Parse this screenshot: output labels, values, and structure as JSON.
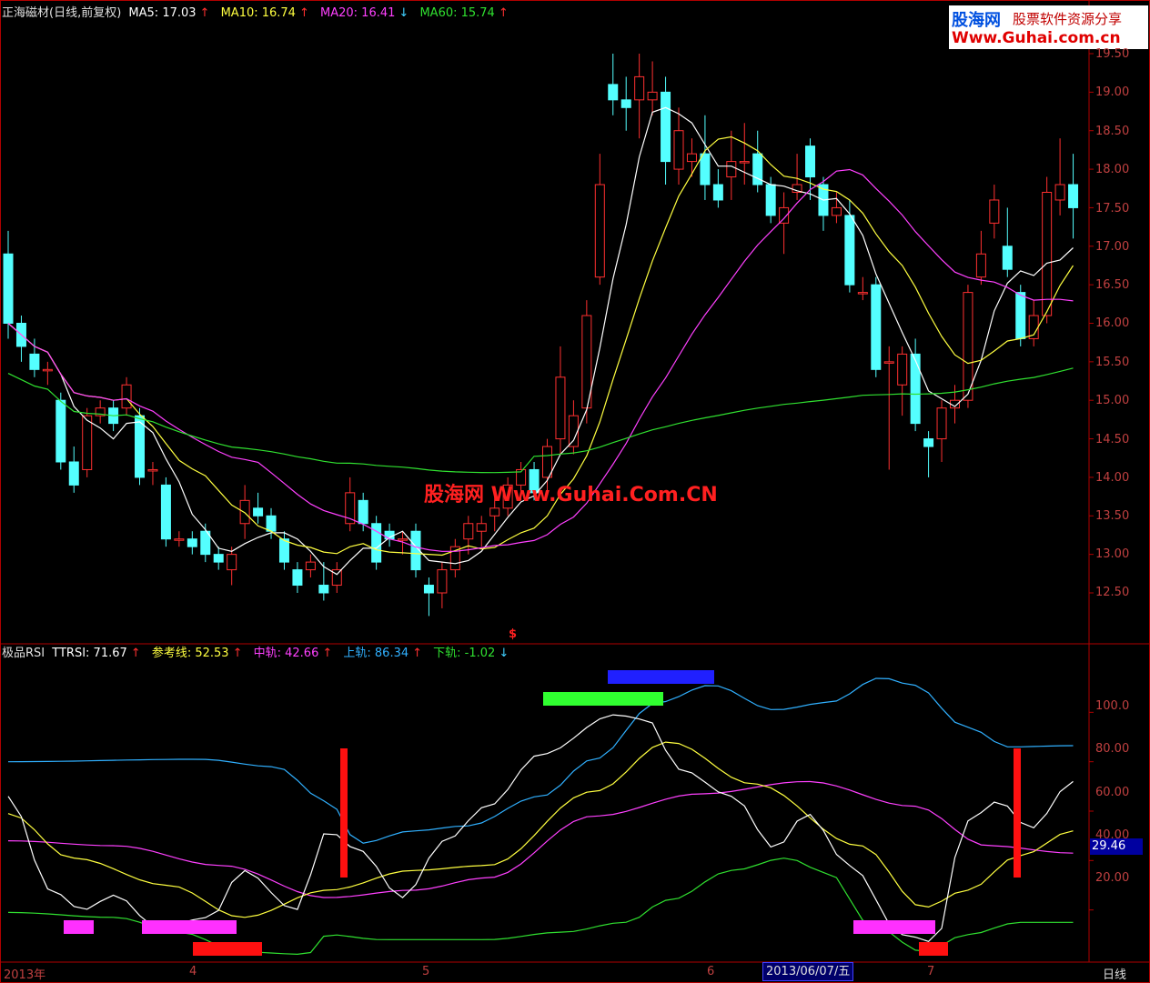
{
  "price_header": {
    "title": "正海磁材(日线,前复权)",
    "ma5": "MA5: 17.03",
    "ma10": "MA10: 16.74",
    "ma20": "MA20: 16.41",
    "ma60": "MA60: 15.74",
    "up_arrow": "↑",
    "down_arrow": "↓"
  },
  "rsi_header": {
    "title": "极品RSI",
    "ttrsi": "TTRSI: 71.67",
    "ref": "参考线: 52.53",
    "mid": "中轨: 42.66",
    "upper": "上轨: 86.34",
    "lower": "下轨: -1.02"
  },
  "logo": {
    "brand": "股海网",
    "tagline": "股票软件资源分享",
    "url": "Www.Guhai.com.cn"
  },
  "watermark": "股海网 Www.Guhai.Com.CN",
  "price_axis": [
    "19.50",
    "19.00",
    "18.50",
    "18.00",
    "17.50",
    "17.00",
    "16.50",
    "16.00",
    "15.50",
    "15.00",
    "14.50",
    "14.00",
    "13.50",
    "13.00",
    "12.50"
  ],
  "rsi_axis": [
    "100.0",
    "80.00",
    "60.00",
    "40.00",
    "20.00"
  ],
  "rsi_current": "29.46",
  "x_labels": {
    "year": "2013年",
    "m4": "4",
    "m5": "5",
    "m6": "6",
    "m7": "7"
  },
  "cursor_date": "2013/06/07/五",
  "period": "日线",
  "signal_marker": "$",
  "colors": {
    "up": "#ff3030",
    "down": "#54ffff",
    "ma5": "#ffffff",
    "ma10": "#ffff40",
    "ma20": "#ff40ff",
    "ma60": "#30e030",
    "upper": "#30b0ff",
    "lower": "#30e030"
  },
  "chart_data": {
    "type": "candlestick",
    "price_axis_range": [
      12.2,
      19.6
    ],
    "candles": [
      [
        16.9,
        16.0,
        17.2,
        15.8
      ],
      [
        16.0,
        15.7,
        16.1,
        15.5
      ],
      [
        15.6,
        15.4,
        15.8,
        15.3
      ],
      [
        15.4,
        15.4,
        15.5,
        15.2
      ],
      [
        15.0,
        14.2,
        15.1,
        14.1
      ],
      [
        14.2,
        13.9,
        14.4,
        13.8
      ],
      [
        14.1,
        14.8,
        14.9,
        14.0
      ],
      [
        14.8,
        14.9,
        15.0,
        14.7
      ],
      [
        14.9,
        14.7,
        15.0,
        14.6
      ],
      [
        14.9,
        15.2,
        15.3,
        14.8
      ],
      [
        14.8,
        14.0,
        14.9,
        13.9
      ],
      [
        14.1,
        14.1,
        14.2,
        13.9
      ],
      [
        13.9,
        13.2,
        14.0,
        13.1
      ],
      [
        13.2,
        13.2,
        13.3,
        13.1
      ],
      [
        13.2,
        13.1,
        13.3,
        13.0
      ],
      [
        13.3,
        13.0,
        13.4,
        12.9
      ],
      [
        13.0,
        12.9,
        13.1,
        12.8
      ],
      [
        12.8,
        13.0,
        13.1,
        12.6
      ],
      [
        13.4,
        13.7,
        13.9,
        13.2
      ],
      [
        13.6,
        13.5,
        13.8,
        13.4
      ],
      [
        13.5,
        13.3,
        13.6,
        13.2
      ],
      [
        13.2,
        12.9,
        13.3,
        12.8
      ],
      [
        12.8,
        12.6,
        12.9,
        12.5
      ],
      [
        12.8,
        12.9,
        13.0,
        12.7
      ],
      [
        12.6,
        12.5,
        12.9,
        12.4
      ],
      [
        12.6,
        12.8,
        12.9,
        12.5
      ],
      [
        13.4,
        13.8,
        14.0,
        13.3
      ],
      [
        13.7,
        13.4,
        13.8,
        13.3
      ],
      [
        13.4,
        12.9,
        13.5,
        12.8
      ],
      [
        13.3,
        13.2,
        13.4,
        13.1
      ],
      [
        13.2,
        13.2,
        13.3,
        13.0
      ],
      [
        13.3,
        12.8,
        13.4,
        12.7
      ],
      [
        12.6,
        12.5,
        12.7,
        12.2
      ],
      [
        12.5,
        12.8,
        12.9,
        12.3
      ],
      [
        12.8,
        13.1,
        13.2,
        12.7
      ],
      [
        13.2,
        13.4,
        13.5,
        13.0
      ],
      [
        13.3,
        13.4,
        13.5,
        13.1
      ],
      [
        13.5,
        13.6,
        13.8,
        13.3
      ],
      [
        13.6,
        13.9,
        14.0,
        13.5
      ],
      [
        13.9,
        14.1,
        14.2,
        13.7
      ],
      [
        14.1,
        13.8,
        14.2,
        13.7
      ],
      [
        14.0,
        14.4,
        14.5,
        13.8
      ],
      [
        14.5,
        15.3,
        15.7,
        14.3
      ],
      [
        14.4,
        14.8,
        15.0,
        14.3
      ],
      [
        14.9,
        16.1,
        16.3,
        14.7
      ],
      [
        16.6,
        17.8,
        18.2,
        16.5
      ],
      [
        19.1,
        18.9,
        19.5,
        18.7
      ],
      [
        18.9,
        18.8,
        19.2,
        18.5
      ],
      [
        18.9,
        19.2,
        19.5,
        18.4
      ],
      [
        18.9,
        19.0,
        19.4,
        18.7
      ],
      [
        19.0,
        18.1,
        19.2,
        17.8
      ],
      [
        18.0,
        18.5,
        18.8,
        17.8
      ],
      [
        18.1,
        18.2,
        18.4,
        17.9
      ],
      [
        18.2,
        17.8,
        18.7,
        17.6
      ],
      [
        17.8,
        17.6,
        18.0,
        17.5
      ],
      [
        17.9,
        18.1,
        18.5,
        17.6
      ],
      [
        18.1,
        18.1,
        18.6,
        17.8
      ],
      [
        18.2,
        17.8,
        18.5,
        17.7
      ],
      [
        17.8,
        17.4,
        17.9,
        17.3
      ],
      [
        17.3,
        17.5,
        17.7,
        16.9
      ],
      [
        17.7,
        17.8,
        18.2,
        17.6
      ],
      [
        18.3,
        17.9,
        18.4,
        17.6
      ],
      [
        17.8,
        17.4,
        17.9,
        17.2
      ],
      [
        17.4,
        17.5,
        17.7,
        17.3
      ],
      [
        17.4,
        16.5,
        17.6,
        16.4
      ],
      [
        16.4,
        16.4,
        16.6,
        16.3
      ],
      [
        16.5,
        15.4,
        16.6,
        15.3
      ],
      [
        15.5,
        15.5,
        15.7,
        14.1
      ],
      [
        15.2,
        15.6,
        15.7,
        14.8
      ],
      [
        15.6,
        14.7,
        15.8,
        14.6
      ],
      [
        14.5,
        14.4,
        14.6,
        14.0
      ],
      [
        14.5,
        14.9,
        15.0,
        14.2
      ],
      [
        14.9,
        15.0,
        15.2,
        14.7
      ],
      [
        15.0,
        16.4,
        16.5,
        14.9
      ],
      [
        16.6,
        16.9,
        17.2,
        16.5
      ],
      [
        17.3,
        17.6,
        17.8,
        17.1
      ],
      [
        17.0,
        16.7,
        17.5,
        16.6
      ],
      [
        16.4,
        15.8,
        16.5,
        15.7
      ],
      [
        15.8,
        16.1,
        16.3,
        15.7
      ],
      [
        16.1,
        17.7,
        17.9,
        16.0
      ],
      [
        17.6,
        17.8,
        18.4,
        17.4
      ],
      [
        17.8,
        17.5,
        18.2,
        17.1
      ]
    ],
    "ma_values_last": {
      "MA5": 17.03,
      "MA10": 16.74,
      "MA20": 16.41,
      "MA60": 15.74
    },
    "rsi": {
      "axis_range": [
        0,
        120
      ],
      "ttrsi_last": 71.67,
      "ref_last": 52.53,
      "mid_last": 42.66,
      "upper_last": 86.34,
      "lower_last": -1.02
    }
  }
}
